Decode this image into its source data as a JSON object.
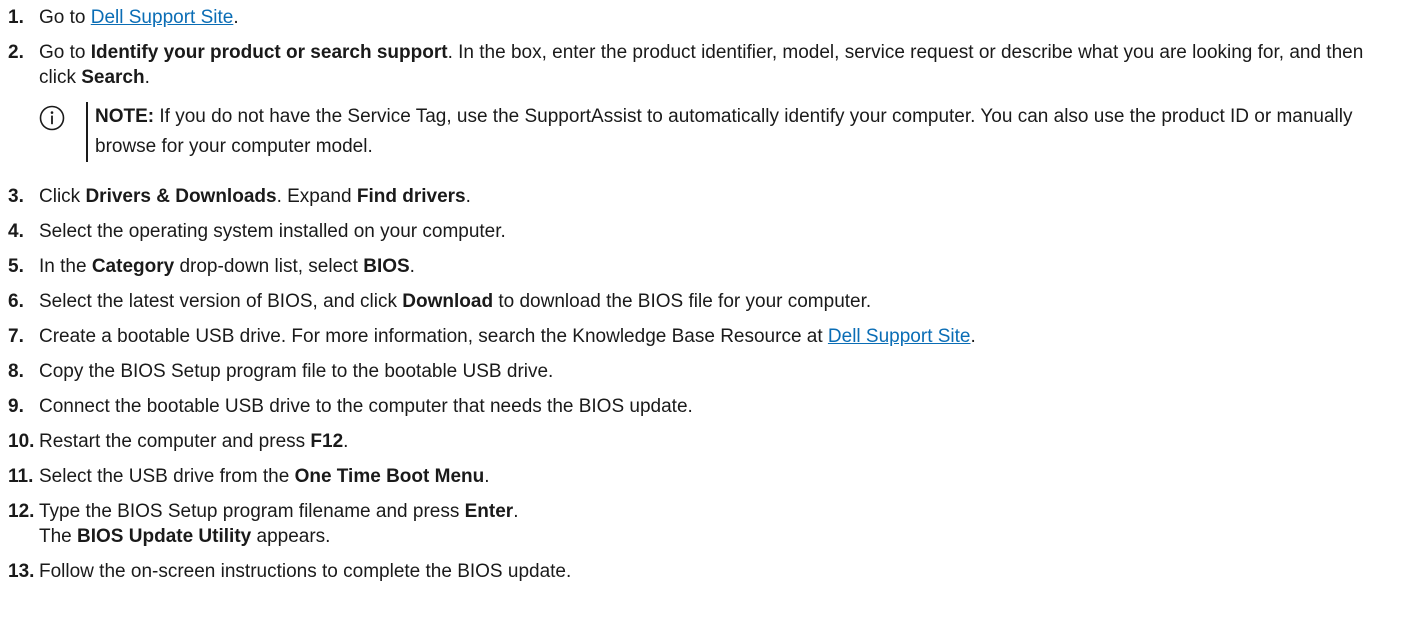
{
  "steps": [
    {
      "num": "1.",
      "pre": "Go to ",
      "link": "Dell Support Site",
      "post": "."
    },
    {
      "num": "2.",
      "t1": "Go to ",
      "b1": "Identify your product or search support",
      "t2": ". In the box, enter the product identifier, model, service request or describe what you are looking for, and then click ",
      "b2": "Search",
      "t3": "."
    },
    {
      "num": "3.",
      "t1": "Click ",
      "b1": "Drivers & Downloads",
      "t2": ". Expand ",
      "b2": "Find drivers",
      "t3": "."
    },
    {
      "num": "4.",
      "t1": "Select the operating system installed on your computer."
    },
    {
      "num": "5.",
      "t1": "In the ",
      "b1": "Category",
      "t2": " drop-down list, select ",
      "b2": "BIOS",
      "t3": "."
    },
    {
      "num": "6.",
      "t1": "Select the latest version of BIOS, and click ",
      "b1": "Download",
      "t2": " to download the BIOS file for your computer."
    },
    {
      "num": "7.",
      "t1": "Create a bootable USB drive. For more information, search the Knowledge Base Resource at ",
      "link": "Dell Support Site",
      "t2": "."
    },
    {
      "num": "8.",
      "t1": "Copy the BIOS Setup program file to the bootable USB drive."
    },
    {
      "num": "9.",
      "t1": "Connect the bootable USB drive to the computer that needs the BIOS update."
    },
    {
      "num": "10.",
      "t1": "Restart the computer and press ",
      "b1": "F12",
      "t2": "."
    },
    {
      "num": "11.",
      "t1": "Select the USB drive from the ",
      "b1": "One Time Boot Menu",
      "t2": "."
    },
    {
      "num": "12.",
      "t1": "Type the BIOS Setup program filename and press ",
      "b1": "Enter",
      "t2": ".",
      "t3": "The ",
      "b2": "BIOS Update Utility",
      "t4": " appears."
    },
    {
      "num": "13.",
      "t1": "Follow the on-screen instructions to complete the BIOS update."
    }
  ],
  "note": {
    "label": "NOTE:",
    "text": " If you do not have the Service Tag, use the SupportAssist to automatically identify your computer. You can also use the product ID or manually browse for your computer model.",
    "icon": "info-circle-icon"
  }
}
